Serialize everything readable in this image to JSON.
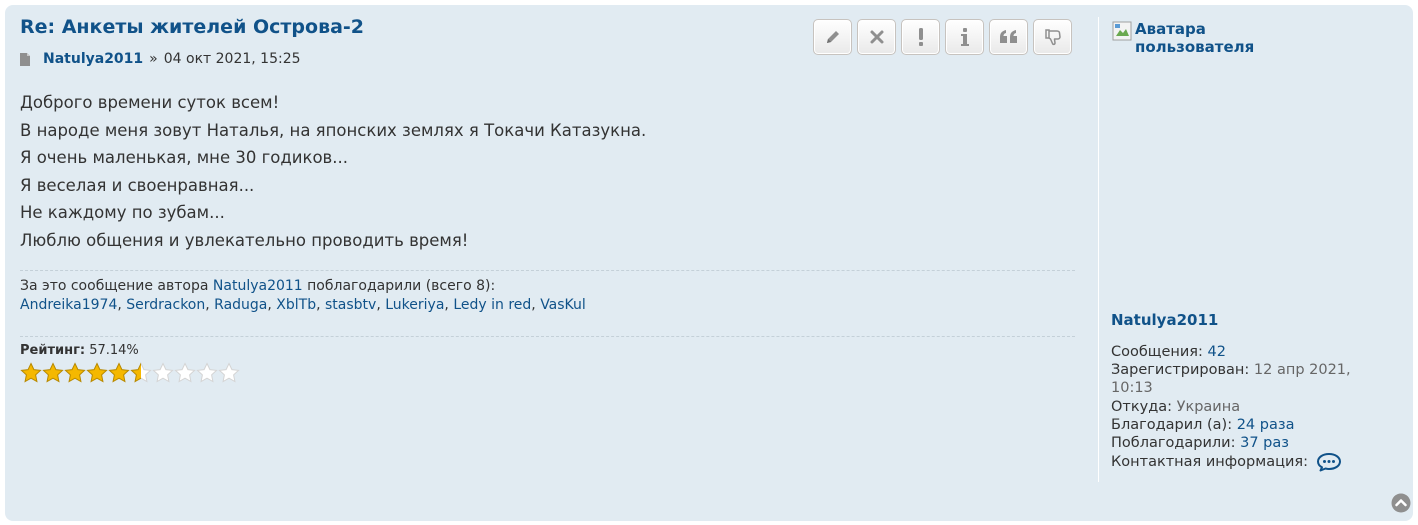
{
  "post": {
    "title": "Re: Анкеты жителей Острова-2",
    "author": "Natulya2011",
    "separator": "»",
    "date": "04 окт 2021, 15:25",
    "content_lines": [
      "Доброго времени суток всем!",
      "В народе меня зовут Наталья, на японских землях я Токачи Катазукна.",
      "Я очень маленькая, мне 30 годиков...",
      "Я веселая и своенравная...",
      "Не каждому по зубам...",
      "Люблю общения и увлекательно проводить время!"
    ]
  },
  "actions": [
    {
      "name": "edit-icon"
    },
    {
      "name": "delete-icon"
    },
    {
      "name": "report-icon"
    },
    {
      "name": "info-icon"
    },
    {
      "name": "quote-icon"
    },
    {
      "name": "thumbs-down-icon"
    }
  ],
  "thanks": {
    "prefix": "За это сообщение автора ",
    "author": "Natulya2011",
    "suffix": " поблагодарили (всего 8):",
    "users": [
      "Andreika1974",
      "Serdrackon",
      "Raduga",
      "XblTb",
      "stasbtv",
      "Lukeriya",
      "Ledy in red",
      "VasKul"
    ],
    "comma": ", "
  },
  "rating": {
    "label": "Рейтинг:",
    "value": "57.14%",
    "stars_total": 10,
    "stars_filled": 5.5
  },
  "profile": {
    "avatar_alt": "Аватара пользователя",
    "name": "Natulya2011",
    "posts_label": "Сообщения: ",
    "posts_value": "42",
    "registered_label": "Зарегистрирован: ",
    "registered_value_1": "12 апр 2021,",
    "registered_value_2": "10:13",
    "from_label": "Откуда: ",
    "from_value": "Украина",
    "thanked_label": "Благодарил (а): ",
    "thanked_value": "24 раза",
    "was_thanked_label": "Поблагодарили: ",
    "was_thanked_value": "37 раз",
    "contact_label": "Контактная информация:"
  },
  "colors": {
    "link": "#105289",
    "background": "#e1ebf2",
    "star": "#f5b800"
  }
}
